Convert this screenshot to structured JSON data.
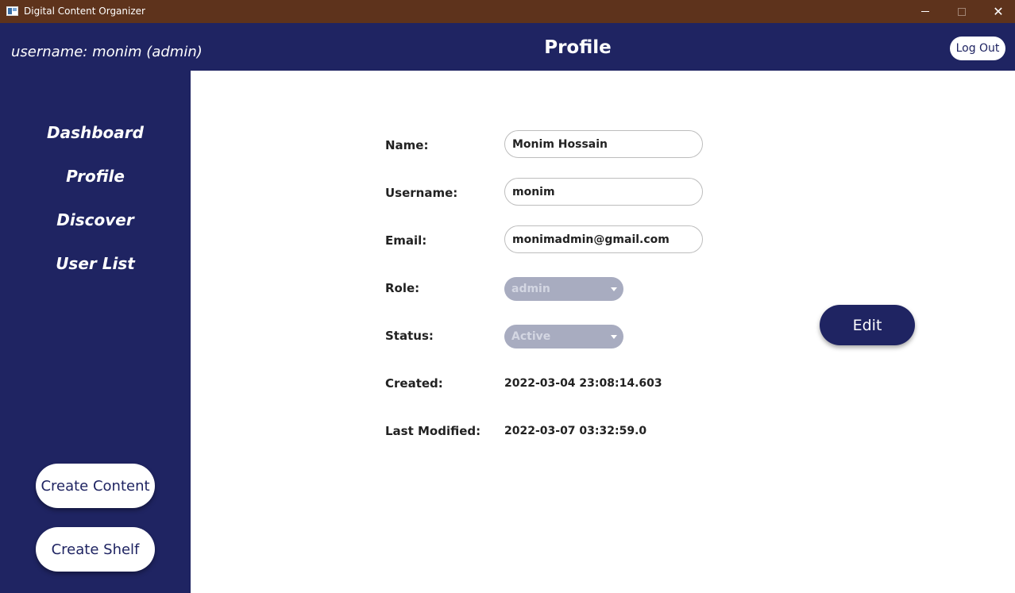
{
  "window": {
    "title": "Digital Content Organizer",
    "minimize_icon": "minimize-icon",
    "maximize_icon": "maximize-icon",
    "close_icon": "close-icon",
    "close_glyph": "✕"
  },
  "header": {
    "user_label": "username: monim (admin)",
    "page_title": "Profile",
    "logout_label": "Log Out"
  },
  "sidebar": {
    "items": [
      {
        "label": "Dashboard"
      },
      {
        "label": "Profile"
      },
      {
        "label": "Discover"
      },
      {
        "label": "User List"
      }
    ],
    "create_content_label": "Create Content",
    "create_shelf_label": "Create Shelf"
  },
  "form": {
    "name_label": "Name:",
    "name_value": "Monim Hossain",
    "username_label": "Username:",
    "username_value": "monim",
    "email_label": "Email:",
    "email_value": "monimadmin@gmail.com",
    "role_label": "Role:",
    "role_value": "admin",
    "status_label": "Status:",
    "status_value": "Active",
    "created_label": "Created:",
    "created_value": "2022-03-04 23:08:14.603",
    "modified_label": "Last Modified:",
    "modified_value": "2022-03-07 03:32:59.0",
    "edit_label": "Edit"
  },
  "colors": {
    "titlebar": "#5e331c",
    "primary": "#1f2462",
    "disabled_select": "#a8acc0",
    "background": "#ffffff"
  }
}
